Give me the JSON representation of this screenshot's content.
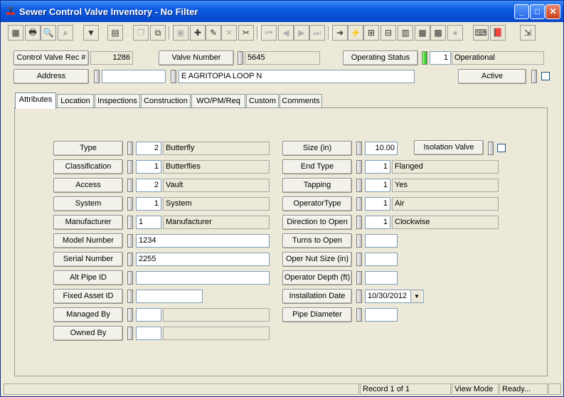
{
  "window": {
    "title": "Sewer Control Valve Inventory - No Filter"
  },
  "header": {
    "rec_label": "Control Valve Rec #",
    "rec_value": "1286",
    "valve_label": "Valve Number",
    "valve_value": "5645",
    "status_label": "Operating Status",
    "status_code": "1",
    "status_value": "Operational",
    "address_label": "Address",
    "address_num": "",
    "address_street": "E AGRITOPIA LOOP N",
    "active_label": "Active"
  },
  "tabs": [
    "Attributes",
    "Location",
    "Inspections",
    "Construction",
    "WO/PM/Req",
    "Custom",
    "Comments"
  ],
  "left_fields": [
    {
      "label": "Type",
      "code": "2",
      "value": "Butterfly"
    },
    {
      "label": "Classification",
      "code": "1",
      "value": "Butterflies"
    },
    {
      "label": "Access",
      "code": "2",
      "value": "Vault"
    },
    {
      "label": "System",
      "code": "1",
      "value": "System"
    },
    {
      "label": "Manufacturer",
      "code": "1",
      "value": "Manufacturer"
    },
    {
      "label": "Model Number",
      "value": "1234"
    },
    {
      "label": "Serial Number",
      "value": "2255"
    },
    {
      "label": "Alt Pipe ID",
      "value": ""
    },
    {
      "label": "Fixed Asset ID",
      "value": ""
    },
    {
      "label": "Managed By",
      "code": "",
      "value": ""
    },
    {
      "label": "Owned By",
      "code": "",
      "value": ""
    }
  ],
  "right_fields": [
    {
      "label": "Size (in)",
      "value": "10.00"
    },
    {
      "label": "End Type",
      "code": "1",
      "value": "Flanged"
    },
    {
      "label": "Tapping",
      "code": "1",
      "value": "Yes"
    },
    {
      "label": "OperatorType",
      "code": "1",
      "value": "Air"
    },
    {
      "label": "Direction to Open",
      "code": "1",
      "value": "Clockwise"
    },
    {
      "label": "Turns to Open",
      "value": ""
    },
    {
      "label": "Oper Nut Size (in)",
      "value": ""
    },
    {
      "label": "Operator Depth (ft)",
      "value": ""
    },
    {
      "label": "Installation Date",
      "value": "10/30/2012"
    },
    {
      "label": "Pipe Diameter",
      "value": ""
    }
  ],
  "isolation_label": "Isolation Valve",
  "statusbar": {
    "record": "Record 1 of 1",
    "mode": "View Mode",
    "state": "Ready..."
  }
}
